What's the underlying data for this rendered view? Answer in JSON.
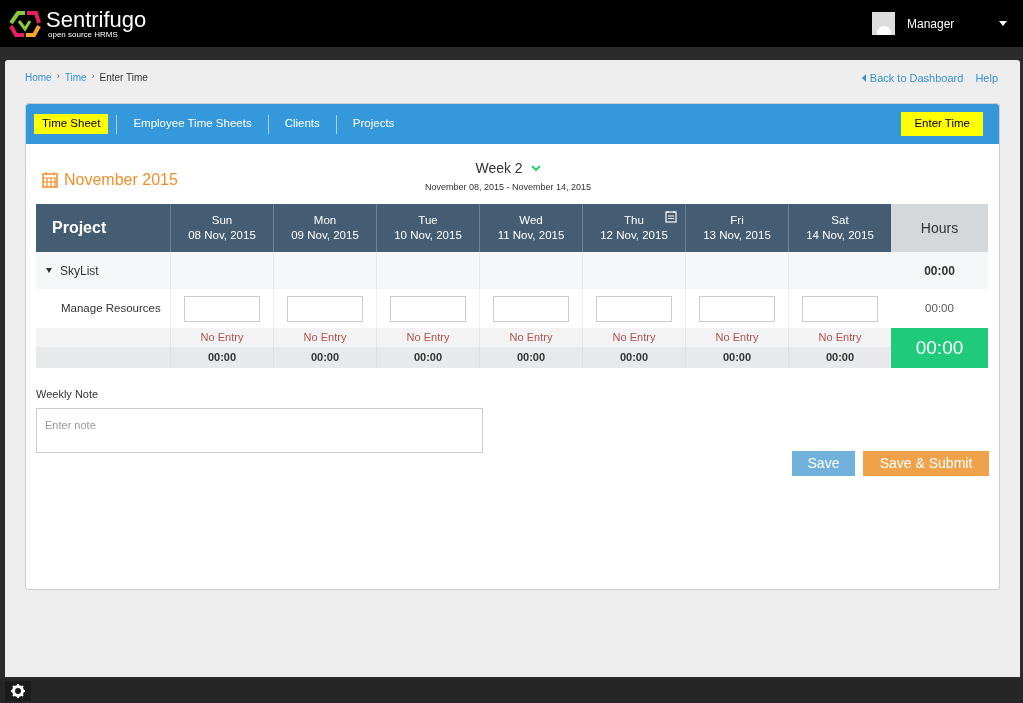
{
  "header": {
    "brand": "Sentrifugo",
    "tagline": "open source HRMS",
    "user": "Manager"
  },
  "breadcrumb": [
    "Home",
    "Time",
    "Enter Time"
  ],
  "breadcrumb_separator": "›",
  "top_links": {
    "back": "Back to Dashboard",
    "help": "Help"
  },
  "tabs": [
    {
      "label": "Time Sheet",
      "selected": true
    },
    {
      "label": "Employee Time Sheets",
      "selected": false
    },
    {
      "label": "Clients",
      "selected": false
    },
    {
      "label": "Projects",
      "selected": false
    }
  ],
  "enter_time_button": "Enter Time",
  "month": "November 2015",
  "week": {
    "label": "Week 2",
    "range": "November 08, 2015 - November 14, 2015"
  },
  "table": {
    "project_heading": "Project",
    "hours_heading": "Hours",
    "days": [
      {
        "day": "Sun",
        "date": "08 Nov, 2015",
        "has_note": false,
        "status": "No Entry",
        "total": "00:00"
      },
      {
        "day": "Mon",
        "date": "09 Nov, 2015",
        "has_note": false,
        "status": "No Entry",
        "total": "00:00"
      },
      {
        "day": "Tue",
        "date": "10 Nov, 2015",
        "has_note": false,
        "status": "No Entry",
        "total": "00:00"
      },
      {
        "day": "Wed",
        "date": "11 Nov, 2015",
        "has_note": false,
        "status": "No Entry",
        "total": "00:00"
      },
      {
        "day": "Thu",
        "date": "12 Nov, 2015",
        "has_note": true,
        "status": "No Entry",
        "total": "00:00"
      },
      {
        "day": "Fri",
        "date": "13 Nov, 2015",
        "has_note": false,
        "status": "No Entry",
        "total": "00:00"
      },
      {
        "day": "Sat",
        "date": "14 Nov, 2015",
        "has_note": false,
        "status": "No Entry",
        "total": "00:00"
      }
    ],
    "project": {
      "name": "SkyList",
      "expanded": true,
      "hours": "00:00",
      "task": "Manage Resources",
      "task_hours": "00:00"
    },
    "grand_total": "00:00"
  },
  "weekly_note": {
    "label": "Weekly Note",
    "placeholder": "Enter note"
  },
  "buttons": {
    "save": "Save",
    "submit": "Save & Submit"
  }
}
